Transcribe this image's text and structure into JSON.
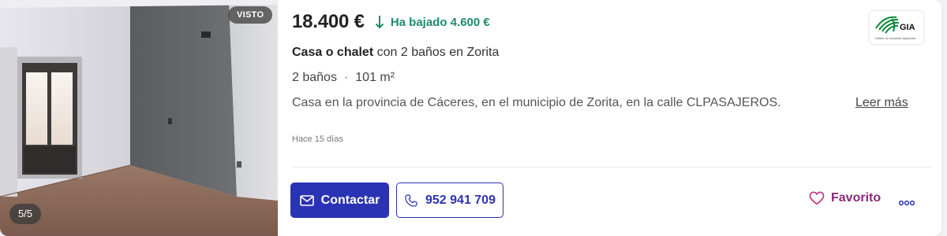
{
  "listing": {
    "seen_badge": "VISTO",
    "photo_counter": "5/5",
    "price": "18.400 €",
    "price_drop": "Ha bajado 4.600 €",
    "title_bold": "Casa o chalet",
    "title_rest": " con 2 baños en Zorita",
    "features": [
      "2 baños",
      "101 m²"
    ],
    "feature_separator": "·",
    "description": "Casa en la provincia de Cáceres, en el municipio de Zorita, en la calle CLPASAJEROS.",
    "read_more": "Leer más",
    "date": "Hace 15 días",
    "agency_logo_text": "GIA",
    "agency_logo_subtext": "Gestión de Inmuebles Adquiridos"
  },
  "actions": {
    "contact_label": "Contactar",
    "phone_label": "952 941 709",
    "favorite_label": "Favorito"
  },
  "icons": {
    "price_drop": "arrow-down-icon",
    "contact": "mail-icon",
    "phone": "phone-icon",
    "favorite": "heart-outline-icon",
    "more": "more-dots-icon"
  },
  "colors": {
    "primary": "#2b33b5",
    "price_drop": "#1e8a6e",
    "favorite": "#8a2a7a",
    "agency_green": "#0a8a3a"
  }
}
